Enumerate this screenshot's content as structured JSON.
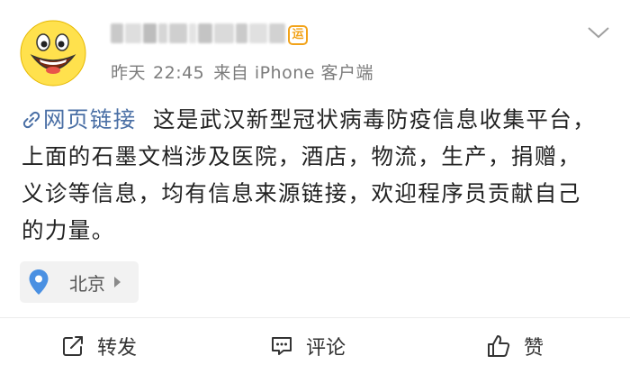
{
  "post": {
    "author": {
      "name": "",
      "vip_badge": "运",
      "avatar_icon": "smiley-face-icon"
    },
    "meta": {
      "date": "昨天",
      "time": "22:45",
      "source": "来自 iPhone 客户端"
    },
    "weblink_label": "网页链接",
    "body_text": "这是武汉新型冠状病毒防疫信息收集平台，上面的石墨文档涉及医院，酒店，物流，生产，捐赠，义诊等信息，均有信息来源链接，欢迎程序员贡献自己的力量。",
    "location": "北京"
  },
  "actions": {
    "repost": "转发",
    "comment": "评论",
    "like": "赞"
  },
  "colors": {
    "link": "#4a6fa5",
    "badge": "#f2a31a",
    "text": "#222222",
    "meta": "#7c7c7c",
    "pin": "#4a90e2"
  }
}
